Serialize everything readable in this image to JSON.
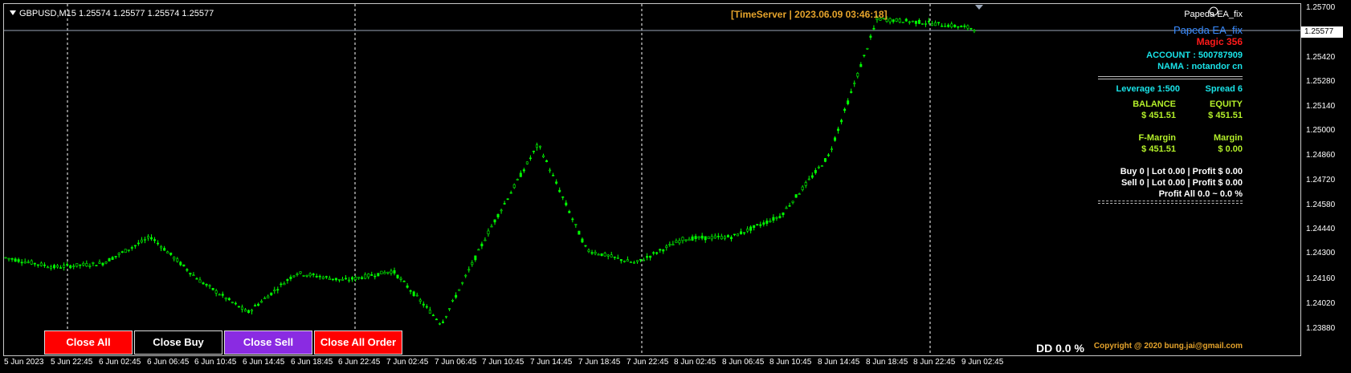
{
  "symbol": "GBPUSD,M15  1.25574 1.25577 1.25574 1.25577",
  "timeserver": "[TimeServer | 2023.06.09 03:46:18]",
  "ea": {
    "title_small": "Papeda EA_fix",
    "title": "Papeda EA_fix",
    "magic": "Magic 356"
  },
  "account": {
    "account": "ACCOUNT : 500787909",
    "nama": "NAMA : notandor cn"
  },
  "leverage": "Leverage  1:500",
  "spread": "Spread  6",
  "balance": {
    "label": "BALANCE",
    "value": "$ 451.51"
  },
  "equity": {
    "label": "EQUITY",
    "value": "$ 451.51"
  },
  "fmargin": {
    "label": "F-Margin",
    "value": "$ 451.51"
  },
  "margin": {
    "label": "Margin",
    "value": "$ 0.00"
  },
  "buy_line": "Buy   0  |  Lot 0.00  |  Profit $ 0.00",
  "sell_line": "Sell   0  |  Lot 0.00  |  Profit $ 0.00",
  "profit_all": "Profit All 0.0 ~ 0.0 %",
  "buttons": {
    "close_all": "Close All",
    "close_buy": "Close Buy",
    "close_sell": "Close Sell",
    "close_all_order": "Close All Order"
  },
  "dd": "DD 0.0 %",
  "copyright": "Copyright @ 2020 bung.jai@gmail.com",
  "current_price": "1.25577",
  "x_axis": [
    "5 Jun 2023",
    "5 Jun 22:45",
    "6 Jun 02:45",
    "6 Jun 06:45",
    "6 Jun 10:45",
    "6 Jun 14:45",
    "6 Jun 18:45",
    "6 Jun 22:45",
    "7 Jun 02:45",
    "7 Jun 06:45",
    "7 Jun 10:45",
    "7 Jun 14:45",
    "7 Jun 18:45",
    "7 Jun 22:45",
    "8 Jun 02:45",
    "8 Jun 06:45",
    "8 Jun 10:45",
    "8 Jun 14:45",
    "8 Jun 18:45",
    "8 Jun 22:45",
    "9 Jun 02:45"
  ],
  "y_axis": [
    "1.25700",
    "1.25420",
    "1.25280",
    "1.25140",
    "1.25000",
    "1.24860",
    "1.24720",
    "1.24580",
    "1.24440",
    "1.24300",
    "1.24160",
    "1.24020",
    "1.23880"
  ],
  "colors": {
    "candles": "#00ff00",
    "accent": "#e5a32b",
    "cyan": "#19e3e8",
    "lime": "#b4f02a",
    "magic": "#ff1a1a"
  },
  "chart_data": {
    "type": "line",
    "x": [
      "5 Jun 2023",
      "5 Jun 22:45",
      "6 Jun 02:45",
      "6 Jun 06:45",
      "6 Jun 10:45",
      "6 Jun 14:45",
      "6 Jun 18:45",
      "6 Jun 22:45",
      "7 Jun 02:45",
      "7 Jun 06:45",
      "7 Jun 10:45",
      "7 Jun 14:45",
      "7 Jun 18:45",
      "7 Jun 22:45",
      "8 Jun 02:45",
      "8 Jun 06:45",
      "8 Jun 10:45",
      "8 Jun 14:45",
      "8 Jun 18:45",
      "8 Jun 22:45",
      "9 Jun 02:45"
    ],
    "series": [
      {
        "values": [
          1.2437,
          1.2432,
          1.2434,
          1.2448,
          1.2425,
          1.2408,
          1.2429,
          1.2425,
          1.243,
          1.2402,
          1.2452,
          1.2497,
          1.2441,
          1.2434,
          1.2447,
          1.2448,
          1.2459,
          1.2491,
          1.2563,
          1.2561,
          1.2558
        ]
      }
    ],
    "ylim": [
      1.2388,
      1.257
    ],
    "grid": false
  }
}
